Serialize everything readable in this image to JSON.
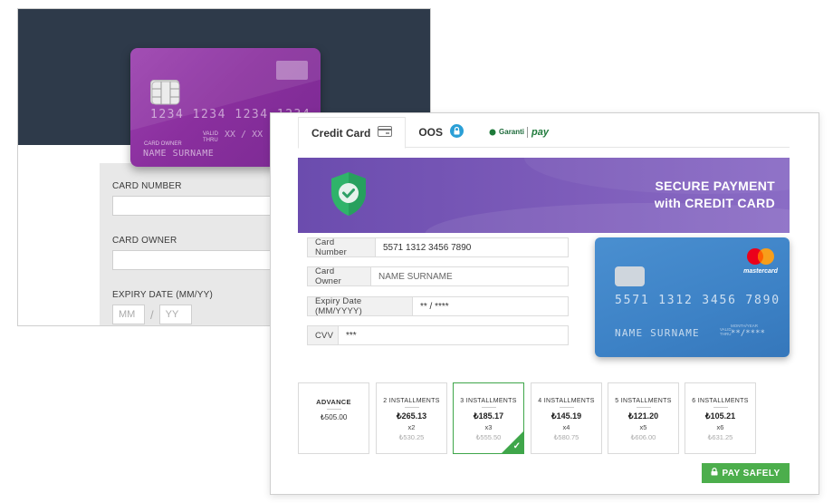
{
  "back_form": {
    "card_number_label": "CARD NUMBER",
    "card_owner_label": "CARD OWNER",
    "expiry_label": "EXPIRY DATE (MM/YY)",
    "mm_placeholder": "MM",
    "yy_placeholder": "YY",
    "slash": "/"
  },
  "purple_card": {
    "number": "1234 1234 1234 1234",
    "owner_label": "CARD OWNER",
    "owner": "NAME SURNAME",
    "valid_label_1": "VALID",
    "valid_label_2": "THRU",
    "expiry": "XX / XX"
  },
  "tabs": [
    {
      "label": "Credit Card",
      "icon": "credit-card-icon"
    },
    {
      "label": "OOS",
      "icon": "lock-icon"
    },
    {
      "label": "Garanti",
      "sublabel": "pay",
      "icon": "garanti-logo"
    }
  ],
  "banner": {
    "line1": "SECURE PAYMENT",
    "line2": "with CREDIT CARD",
    "icon": "shield-check-icon"
  },
  "fields": {
    "card_number_label": "Card Number",
    "card_number_value": "5571 1312 3456 7890",
    "card_owner_label": "Card Owner",
    "card_owner_placeholder": "NAME SURNAME",
    "expiry_label": "Expiry Date (MM/YYYY)",
    "expiry_value": "** / ****",
    "cvv_label": "CVV",
    "cvv_value": "***"
  },
  "blue_card": {
    "brand": "mastercard",
    "number": "5571  1312  3456  7890",
    "name": "NAME  SURNAME",
    "valid_label_1": "VALID",
    "valid_label_2": "THRU",
    "month_year_label": "MONTH/YEAR",
    "expiry": "**/****"
  },
  "installments": [
    {
      "title": "ADVANCE",
      "amount": "₺505.00",
      "count": "",
      "total": "",
      "selected": false
    },
    {
      "title": "2 INSTALLMENTS",
      "amount": "₺265.13",
      "count": "x2",
      "total": "₺530.25",
      "selected": false
    },
    {
      "title": "3 INSTALLMENTS",
      "amount": "₺185.17",
      "count": "x3",
      "total": "₺555.50",
      "selected": true
    },
    {
      "title": "4 INSTALLMENTS",
      "amount": "₺145.19",
      "count": "x4",
      "total": "₺580.75",
      "selected": false
    },
    {
      "title": "5 INSTALLMENTS",
      "amount": "₺121.20",
      "count": "x5",
      "total": "₺606.00",
      "selected": false
    },
    {
      "title": "6 INSTALLMENTS",
      "amount": "₺105.21",
      "count": "x6",
      "total": "₺631.25",
      "selected": false
    }
  ],
  "pay_button": {
    "label": "PAY SAFELY",
    "icon": "lock-icon"
  },
  "colors": {
    "back_header": "#2e3a4a",
    "purple_card": "#8a2f9e",
    "banner": "#7d5cba",
    "blue_card": "#3d82c6",
    "selected_green": "#3fa64a",
    "pay_button": "#4cae4c"
  }
}
